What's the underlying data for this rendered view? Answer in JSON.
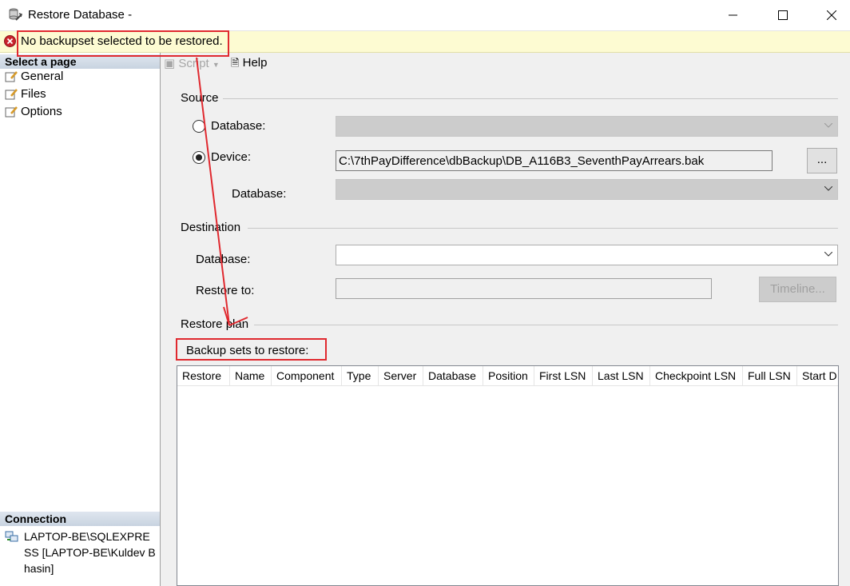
{
  "window": {
    "title": "Restore Database -",
    "controls": [
      "minimize",
      "maximize",
      "close"
    ]
  },
  "error_bar": {
    "icon": "error-icon",
    "message": "No backupset selected to be restored."
  },
  "left_pane": {
    "select_page_header": "Select a page",
    "pages": [
      {
        "label": "General",
        "icon": "page-icon",
        "selected": true
      },
      {
        "label": "Files",
        "icon": "page-icon",
        "selected": false
      },
      {
        "label": "Options",
        "icon": "page-icon",
        "selected": false
      }
    ],
    "connection_header": "Connection",
    "connection_text": "LAPTOP-BE\\SQLEXPRESS [LAPTOP-BE\\Kuldev Bhasin]"
  },
  "toolbar": {
    "script_label": "Script",
    "help_label": "Help"
  },
  "source": {
    "group_label": "Source",
    "database_radio_label": "Database:",
    "device_radio_label": "Device:",
    "selected_radio": "device",
    "device_path": "C:\\7thPayDifference\\dbBackup\\DB_A116B3_SeventhPayArrears.bak",
    "browse_button_label": "...",
    "device_database_label": "Database:"
  },
  "destination": {
    "group_label": "Destination",
    "database_label": "Database:",
    "restore_to_label": "Restore to:",
    "timeline_button_label": "Timeline..."
  },
  "restore_plan": {
    "group_label": "Restore plan",
    "backup_sets_label": "Backup sets to restore:",
    "columns": [
      "Restore",
      "Name",
      "Component",
      "Type",
      "Server",
      "Database",
      "Position",
      "First LSN",
      "Last LSN",
      "Checkpoint LSN",
      "Full LSN",
      "Start D"
    ],
    "rows": []
  },
  "colors": {
    "annotation_red": "#e0292f",
    "error_bar_bg": "#fdfbd2",
    "section_header_bg": "#c8d3e0"
  }
}
